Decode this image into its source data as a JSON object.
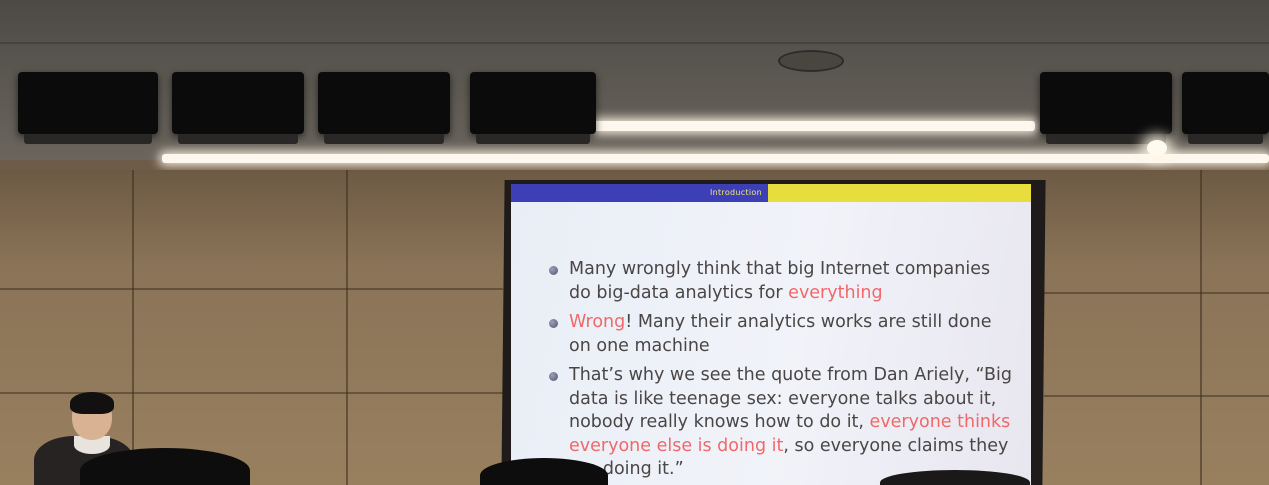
{
  "slide": {
    "section_label": "Introduction",
    "bullets": [
      {
        "parts": [
          {
            "text": "Many wrongly think that big Internet companies do big-data analytics for ",
            "highlight": false
          },
          {
            "text": "everything",
            "highlight": true
          }
        ]
      },
      {
        "parts": [
          {
            "text": "Wrong",
            "highlight": true
          },
          {
            "text": "! Many their analytics works are still done on one machine",
            "highlight": false
          }
        ]
      },
      {
        "parts": [
          {
            "text": "That’s why we see the quote from Dan Ariely, “Big data is like teenage sex: everyone talks about it, nobody really knows how to do it, ",
            "highlight": false
          },
          {
            "text": "everyone thinks everyone else is doing it",
            "highlight": true
          },
          {
            "text": ", so everyone claims they are doing it.”",
            "highlight": false
          }
        ]
      }
    ]
  },
  "colors": {
    "beamer_left": "#3c3fb5",
    "beamer_right": "#e7dd3c",
    "highlight_text": "#f0686a",
    "body_text": "#4a4646"
  }
}
